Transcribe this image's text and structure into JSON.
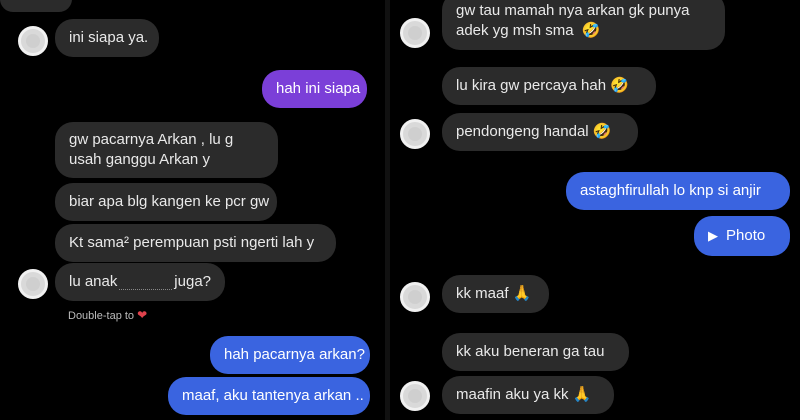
{
  "left": {
    "messages": [
      {
        "text": "ini siapa ya."
      },
      {
        "text": "hah ini siapa"
      },
      {
        "text": "gw pacarnya Arkan , lu g usah ganggu Arkan y"
      },
      {
        "text": "biar apa blg kangen ke pcr gw"
      },
      {
        "text": "Kt sama² perempuan psti ngerti lah y"
      },
      {
        "text_before": "lu anak",
        "text_after": "juga?"
      },
      {
        "text": "hah pacarnya arkan?"
      },
      {
        "text": "maaf, aku tantenya arkan .."
      }
    ],
    "double_tap_label": "Double-tap to",
    "heart_icon": "heart-icon"
  },
  "right": {
    "messages": [
      {
        "text": "gw tau mamah nya arkan gk punya adek yg msh sma"
      },
      {
        "text": "lu kira gw percaya hah"
      },
      {
        "text": "pendongeng handal"
      },
      {
        "text": "astaghfirullah lo knp si anjir"
      },
      {
        "text": "Photo"
      },
      {
        "text": "kk maaf"
      },
      {
        "text": "kk aku beneran ga tau"
      },
      {
        "text": "maafin aku ya kk"
      }
    ],
    "emoji": {
      "laugh": "🤣",
      "pray": "🙏"
    }
  },
  "colors": {
    "received": "#2b2b2b",
    "sent_blue": "#3a64e0",
    "sent_purple": "#7b3fd8",
    "background": "#000000"
  }
}
